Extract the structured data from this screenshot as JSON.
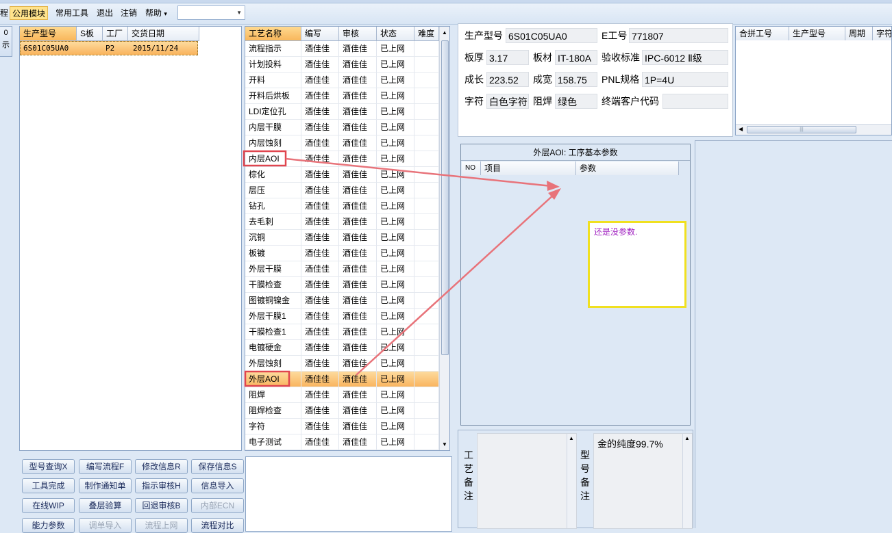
{
  "menu": {
    "items": [
      "程",
      "公用模块",
      "常用工具",
      "退出",
      "注销",
      "帮助"
    ],
    "active_index": 1,
    "help_arrow": "▾"
  },
  "left_stub": {
    "labels": [
      "0",
      "示"
    ]
  },
  "product_table": {
    "headers": [
      "生产型号",
      "S板",
      "工厂",
      "交货日期"
    ],
    "rows": [
      [
        "6S01C05UA0",
        "",
        "P2",
        "2015/11/24"
      ]
    ]
  },
  "process_table": {
    "headers": [
      "工艺名称",
      "编写",
      "审核",
      "状态",
      "难度"
    ],
    "rows": [
      [
        "流程指示",
        "酒佳佳",
        "酒佳佳",
        "已上网"
      ],
      [
        "计划投料",
        "酒佳佳",
        "酒佳佳",
        "已上网"
      ],
      [
        "开料",
        "酒佳佳",
        "酒佳佳",
        "已上网"
      ],
      [
        "开料后烘板",
        "酒佳佳",
        "酒佳佳",
        "已上网"
      ],
      [
        "LDI定位孔",
        "酒佳佳",
        "酒佳佳",
        "已上网"
      ],
      [
        "内层干膜",
        "酒佳佳",
        "酒佳佳",
        "已上网"
      ],
      [
        "内层蚀刻",
        "酒佳佳",
        "酒佳佳",
        "已上网"
      ],
      [
        "内层AOI",
        "酒佳佳",
        "酒佳佳",
        "已上网"
      ],
      [
        "棕化",
        "酒佳佳",
        "酒佳佳",
        "已上网"
      ],
      [
        "层压",
        "酒佳佳",
        "酒佳佳",
        "已上网"
      ],
      [
        "钻孔",
        "酒佳佳",
        "酒佳佳",
        "已上网"
      ],
      [
        "去毛刺",
        "酒佳佳",
        "酒佳佳",
        "已上网"
      ],
      [
        "沉铜",
        "酒佳佳",
        "酒佳佳",
        "已上网"
      ],
      [
        "板镀",
        "酒佳佳",
        "酒佳佳",
        "已上网"
      ],
      [
        "外层干膜",
        "酒佳佳",
        "酒佳佳",
        "已上网"
      ],
      [
        "干膜检查",
        "酒佳佳",
        "酒佳佳",
        "已上网"
      ],
      [
        "图镀铜镍金",
        "酒佳佳",
        "酒佳佳",
        "已上网"
      ],
      [
        "外层干膜1",
        "酒佳佳",
        "酒佳佳",
        "已上网"
      ],
      [
        "干膜检查1",
        "酒佳佳",
        "酒佳佳",
        "已上网"
      ],
      [
        "电镀硬金",
        "酒佳佳",
        "酒佳佳",
        "已上网"
      ],
      [
        "外层蚀刻",
        "酒佳佳",
        "酒佳佳",
        "已上网"
      ],
      [
        "外层AOI",
        "酒佳佳",
        "酒佳佳",
        "已上网"
      ],
      [
        "阻焊",
        "酒佳佳",
        "酒佳佳",
        "已上网"
      ],
      [
        "阻焊检查",
        "酒佳佳",
        "酒佳佳",
        "已上网"
      ],
      [
        "字符",
        "酒佳佳",
        "酒佳佳",
        "已上网"
      ],
      [
        "电子测试",
        "酒佳佳",
        "酒佳佳",
        "已上网"
      ]
    ],
    "selected_index": 21,
    "highlighted_indices": [
      7,
      21
    ]
  },
  "buttons": [
    [
      "型号查询X",
      "编写流程F",
      "修改信息R",
      "保存信息S"
    ],
    [
      "工具完成",
      "制作通知单",
      "指示审核H",
      "信息导入"
    ],
    [
      "在线WIP",
      "叠层验算",
      "回退审核B",
      "内部ECN"
    ],
    [
      "能力参数",
      "调单导入",
      "流程上网",
      "流程对比"
    ]
  ],
  "disabled_buttons": [
    "内部ECN",
    "调单导入",
    "流程上网"
  ],
  "info": {
    "product_model_label": "生产型号",
    "product_model": "6S01C05UA0",
    "e_no_label": "E工号",
    "e_no": "771807",
    "thickness_label": "板厚",
    "thickness": "3.17",
    "material_label": "板材",
    "material": "IT-180A",
    "accept_label": "验收标准",
    "accept": "IPC-6012 Ⅱ级",
    "length_label": "成长",
    "length": "223.52",
    "width_label": "成宽",
    "width": "158.75",
    "pnl_label": "PNL规格",
    "pnl": "1P=4U",
    "char_label": "字符",
    "char": "白色字符",
    "mask_label": "阻焊",
    "mask": "绿色",
    "client_label": "终端客户代码",
    "client": ""
  },
  "combine_table": {
    "headers": [
      "合拼工号",
      "生产型号",
      "周期",
      "字符"
    ]
  },
  "params_panel": {
    "title": "外层AOI: 工序基本参数",
    "headers": [
      "NO",
      "项目",
      "参数"
    ]
  },
  "note": {
    "text": "还是没参数."
  },
  "remarks": {
    "process_label": [
      "工",
      "艺",
      "备",
      "注"
    ],
    "model_label": [
      "型",
      "号",
      "备",
      "注"
    ],
    "model_text": "金的纯度99.7%",
    "process_text": ""
  },
  "colors": {
    "accent_orange": "#f9b35c",
    "annot_red": "#e0454e",
    "arrow": "#e8737a",
    "note_border": "#f0e020",
    "note_text": "#a020c0"
  }
}
